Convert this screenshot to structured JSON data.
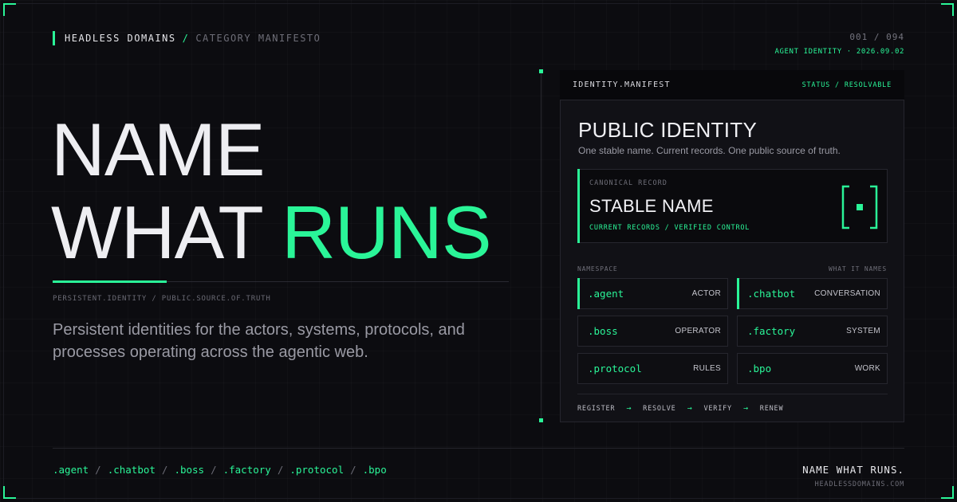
{
  "header": {
    "brand": "HEADLESS DOMAINS",
    "separator": "/",
    "category": "CATEGORY MANIFESTO",
    "counter": "001 / 094",
    "meta": "AGENT IDENTITY · 2026.09.02"
  },
  "hero": {
    "line1": "NAME",
    "line2_a": "WHAT",
    "line2_b": "RUNS",
    "kicker": "PERSISTENT.IDENTITY / PUBLIC.SOURCE.OF.TRUTH",
    "lede": "Persistent identities for the actors, systems, protocols, and processes operating across the agentic web."
  },
  "manifest": {
    "header_title": "IDENTITY.MANIFEST",
    "status": "STATUS / RESOLVABLE",
    "title": "PUBLIC IDENTITY",
    "subtitle": "One stable name. Current records. One public source of truth.",
    "canonical": {
      "label": "CANONICAL RECORD",
      "name": "STABLE NAME",
      "sub": "CURRENT RECORDS / VERIFIED CONTROL",
      "icon": "bracket-dot-icon"
    },
    "namespace_label": "NAMESPACE",
    "names_label": "WHAT IT NAMES",
    "tiles": [
      {
        "tld": ".agent",
        "role": "ACTOR"
      },
      {
        "tld": ".chatbot",
        "role": "CONVERSATION"
      },
      {
        "tld": ".boss",
        "role": "OPERATOR"
      },
      {
        "tld": ".factory",
        "role": "SYSTEM"
      },
      {
        "tld": ".protocol",
        "role": "RULES"
      },
      {
        "tld": ".bpo",
        "role": "WORK"
      }
    ],
    "flow": [
      "REGISTER",
      "RESOLVE",
      "VERIFY",
      "RENEW"
    ],
    "flow_arrow": "→"
  },
  "footer": {
    "tlds": [
      ".agent",
      ".chatbot",
      ".boss",
      ".factory",
      ".protocol",
      ".bpo"
    ],
    "sep": "/",
    "tagline": "NAME WHAT RUNS.",
    "url": "HEADLESSDOMAINS.COM"
  },
  "colors": {
    "accent": "#2af598",
    "background": "#0c0c10",
    "panel": "#111116"
  }
}
